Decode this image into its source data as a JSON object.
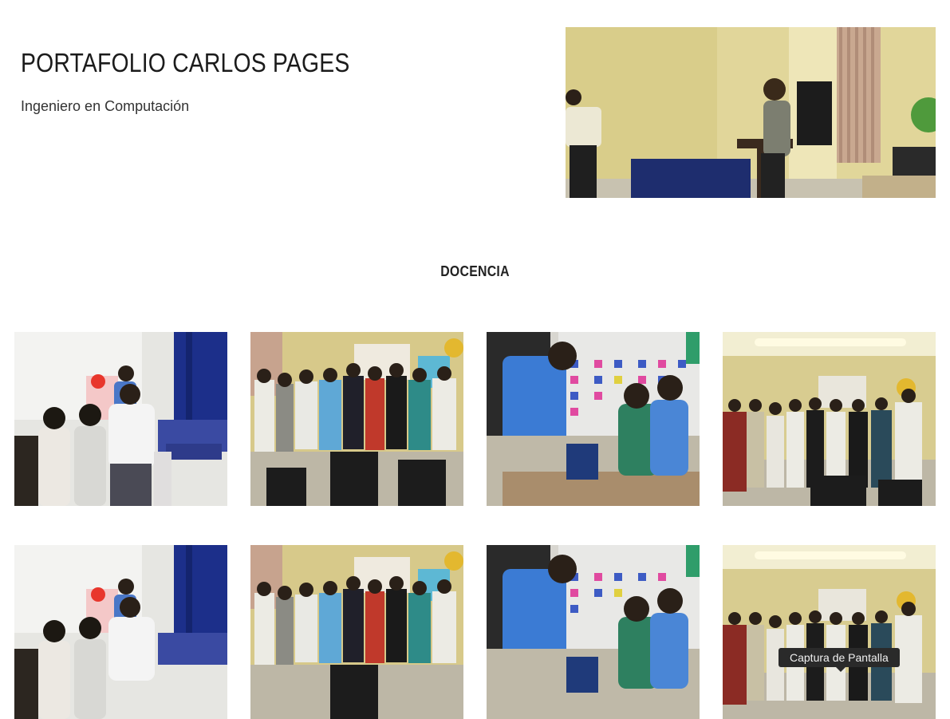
{
  "header": {
    "title": "PORTAFOLIO CARLOS PAGES",
    "subtitle": "Ingeniero en Computación"
  },
  "hero_photo": {
    "icon": "classroom-presentation-photo"
  },
  "section": {
    "title": "DOCENCIA"
  },
  "gallery": {
    "photos": [
      {
        "icon": "teacher-whiteboard-photo"
      },
      {
        "icon": "class-group-photo"
      },
      {
        "icon": "teacher-kids-photo"
      },
      {
        "icon": "stage-group-photo"
      },
      {
        "icon": "teacher-whiteboard-photo"
      },
      {
        "icon": "class-group-photo"
      },
      {
        "icon": "teacher-kids-photo"
      },
      {
        "icon": "stage-group-photo"
      }
    ]
  },
  "tooltip": {
    "text": "Captura de Pantalla"
  },
  "colors": {
    "wall_yellow": "#d8c878",
    "curtain_blue": "#1c2f8a",
    "floor_gray": "#b9b3a4"
  }
}
